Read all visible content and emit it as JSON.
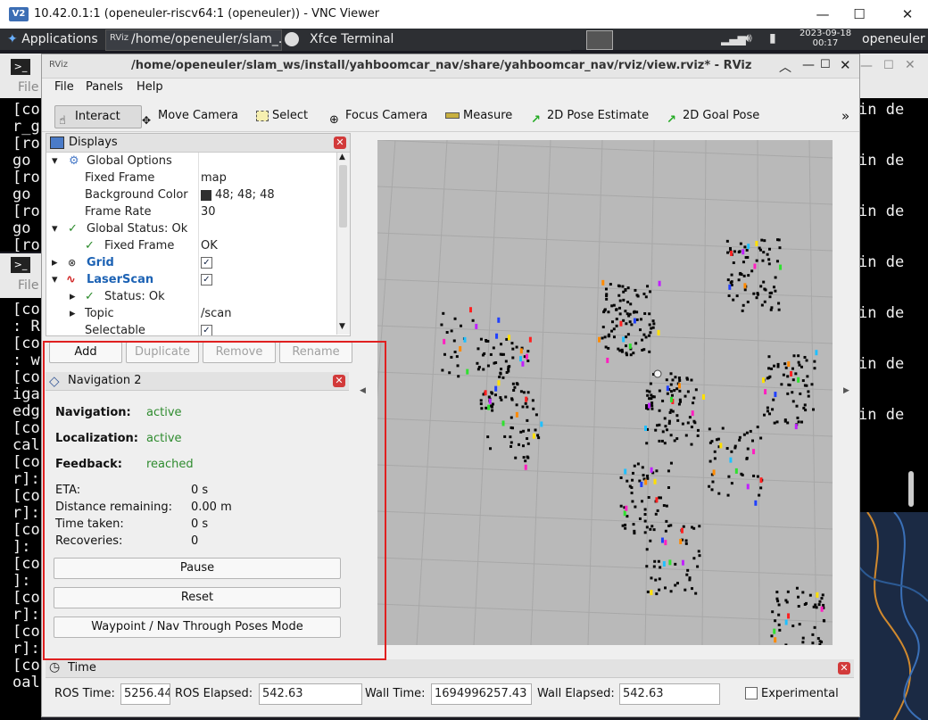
{
  "vnc": {
    "logo": "V2",
    "title": "10.42.0.1:1 (openeuler-riscv64:1 (openeuler)) - VNC Viewer",
    "minimize": "—",
    "maximize": "☐",
    "close": "✕"
  },
  "panel": {
    "applications": "Applications",
    "task1": "/home/openeuler/slam_...",
    "task2": "Xfce Terminal",
    "clock_date": "2023-09-18",
    "clock_time": "00:17",
    "user": "openeuler"
  },
  "terminals": {
    "left_top_lines": [
      "[co",
      "r_g",
      "[ro",
      " go",
      "[ro",
      " go",
      "[ro",
      " go",
      "[ro"
    ],
    "left_bottom_lines": [
      "[co",
      ": R",
      "[co",
      ": w",
      "[co",
      "iga",
      "edg",
      "[co",
      "cal",
      "[co",
      "r]:",
      "[co",
      "r]:",
      "[co",
      "]:",
      "[co",
      "]:",
      "[co",
      "r]:",
      "[co",
      "r]:",
      "[co",
      "oal"
    ],
    "menu_file": "File",
    "right_lines": [
      "in de",
      "in de",
      "in de",
      "in de",
      "in de",
      "in de",
      "in de"
    ]
  },
  "rviz": {
    "title": "/home/openeuler/slam_ws/install/yahboomcar_nav/share/yahboomcar_nav/rviz/view.rviz* - RViz",
    "menu": {
      "file": "File",
      "panels": "Panels",
      "help": "Help"
    },
    "toolbar": {
      "interact": "Interact",
      "move_camera": "Move Camera",
      "select": "Select",
      "focus_camera": "Focus Camera",
      "measure": "Measure",
      "pose_estimate": "2D Pose Estimate",
      "goal_pose": "2D Goal Pose",
      "more": "»"
    },
    "displays": {
      "title": "Displays",
      "rows": {
        "global_options": "Global Options",
        "fixed_frame": "Fixed Frame",
        "fixed_frame_val": "map",
        "background_color": "Background Color",
        "background_color_val": "48; 48; 48",
        "frame_rate": "Frame Rate",
        "frame_rate_val": "30",
        "global_status": "Global Status: Ok",
        "fixed_frame_status": "Fixed Frame",
        "fixed_frame_status_val": "OK",
        "grid": "Grid",
        "laserscan": "LaserScan",
        "status": "Status: Ok",
        "topic": "Topic",
        "topic_val": "/scan",
        "selectable": "Selectable"
      },
      "buttons": {
        "add": "Add",
        "duplicate": "Duplicate",
        "remove": "Remove",
        "rename": "Rename"
      }
    },
    "nav2": {
      "title": "Navigation 2",
      "navigation_label": "Navigation:",
      "navigation_val": "active",
      "localization_label": "Localization:",
      "localization_val": "active",
      "feedback_label": "Feedback:",
      "feedback_val": "reached",
      "eta_label": "ETA:",
      "eta_val": "0 s",
      "distance_label": "Distance remaining:",
      "distance_val": "0.00 m",
      "time_label": "Time taken:",
      "time_val": "0 s",
      "recoveries_label": "Recoveries:",
      "recoveries_val": "0",
      "pause": "Pause",
      "reset": "Reset",
      "waypoint": "Waypoint / Nav Through Poses Mode"
    },
    "time": {
      "title": "Time",
      "ros_time_label": "ROS Time:",
      "ros_time_val": "5256.44",
      "ros_elapsed_label": "ROS Elapsed:",
      "ros_elapsed_val": "542.63",
      "wall_time_label": "Wall Time:",
      "wall_time_val": "1694996257.43",
      "wall_elapsed_label": "Wall Elapsed:",
      "wall_elapsed_val": "542.63",
      "experimental": "Experimental"
    }
  },
  "colors": {
    "highlight_box": "#e02020",
    "status_ok": "#2e8b2e",
    "link_blue": "#1c62b4",
    "background_swatch": "#303030"
  }
}
